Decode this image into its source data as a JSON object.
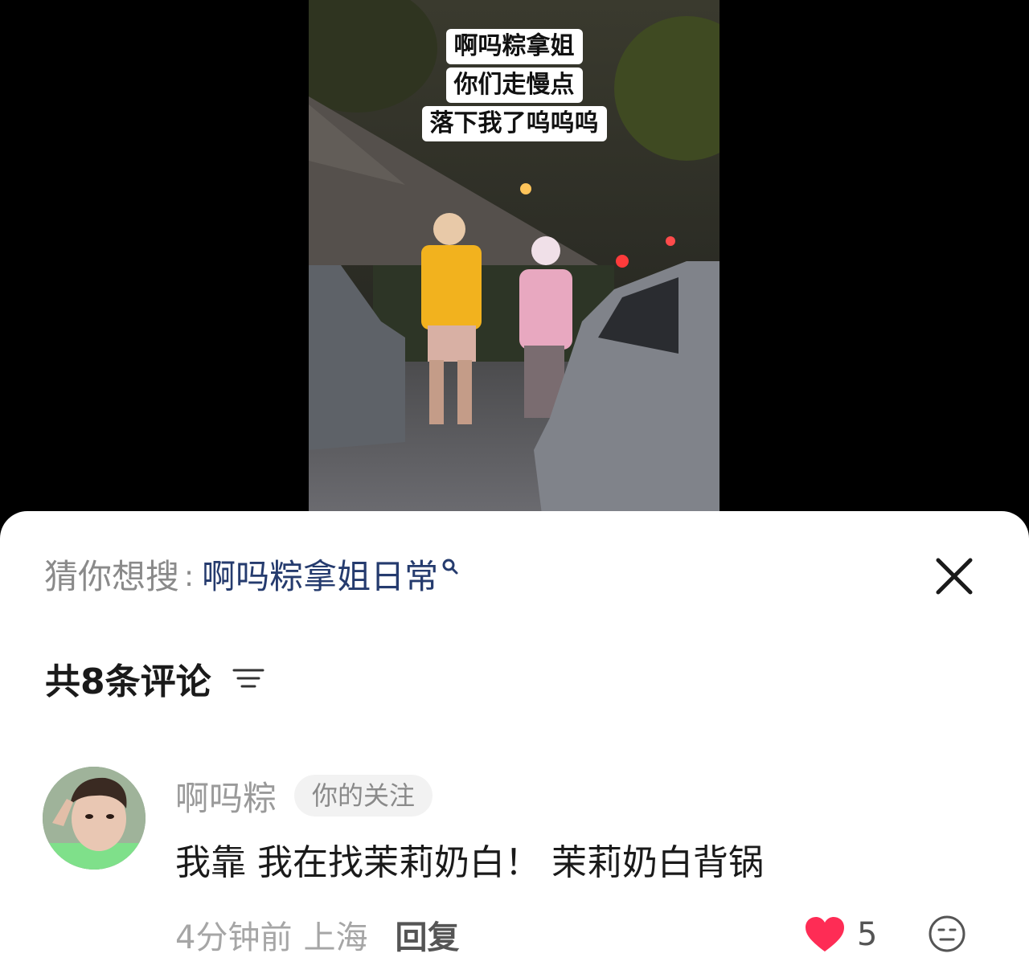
{
  "video": {
    "caption_lines": [
      "啊吗粽拿姐",
      "你们走慢点",
      "落下我了呜呜呜"
    ]
  },
  "suggest": {
    "prefix": "猜你想搜",
    "separator": ":",
    "term": "啊吗粽拿姐日常",
    "close_icon": "close-icon"
  },
  "comments_header": {
    "count_label": "共8条评论",
    "sort_icon": "sort-icon"
  },
  "comment": {
    "author": "啊吗粽",
    "badge": "你的关注",
    "text": "我靠 我在找茉莉奶白！ 茉莉奶白背锅",
    "time": "4分钟前",
    "location": "上海",
    "reply_label": "回复",
    "like_count": "5",
    "liked": true,
    "like_color": "#fe2c55"
  }
}
